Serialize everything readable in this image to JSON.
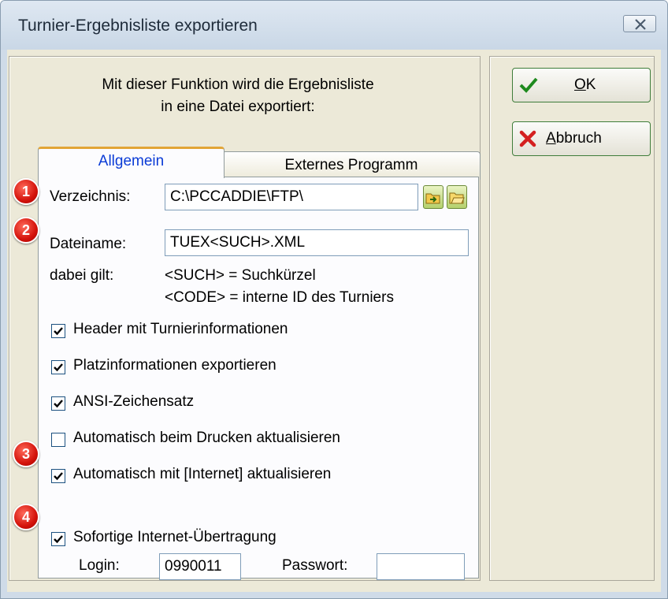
{
  "window": {
    "title": "Turnier-Ergebnisliste exportieren"
  },
  "description": {
    "line1": "Mit dieser Funktion wird die Ergebnisliste",
    "line2": "in eine Datei exportiert:"
  },
  "tabs": [
    {
      "label": "Allgemein",
      "active": true
    },
    {
      "label": "Externes Programm",
      "active": false
    }
  ],
  "form": {
    "directory_label": "Verzeichnis:",
    "directory_value": "C:\\PCCADDIE\\FTP\\",
    "filename_label": "Dateiname:",
    "filename_value": "TUEX<SUCH>.XML",
    "rules_label": "dabei gilt:",
    "rule1": "<SUCH> = Suchkürzel",
    "rule2": "<CODE> = interne ID des Turniers",
    "login_label": "Login:",
    "login_value": "0990011",
    "password_label": "Passwort:",
    "password_value": ""
  },
  "checkboxes": [
    {
      "label": "Header mit Turnierinformationen",
      "checked": true
    },
    {
      "label": "Platzinformationen exportieren",
      "checked": true
    },
    {
      "label": "ANSI-Zeichensatz",
      "checked": true
    },
    {
      "label": "Automatisch beim Drucken aktualisieren",
      "checked": false
    },
    {
      "label": "Automatisch mit [Internet] aktualisieren",
      "checked": true
    },
    {
      "label": "Sofortige Internet-Übertragung",
      "checked": true
    }
  ],
  "badges": [
    "1",
    "2",
    "3",
    "4"
  ],
  "buttons": {
    "ok": {
      "label_underlined": "O",
      "label_rest": "K"
    },
    "cancel": {
      "label_underlined": "A",
      "label_rest": "bbruch"
    }
  },
  "colors": {
    "accent_tab": "#e2a537",
    "active_tab_text": "#0a3bd6",
    "badge": "#d4130b",
    "button_border": "#3f7d3a"
  }
}
